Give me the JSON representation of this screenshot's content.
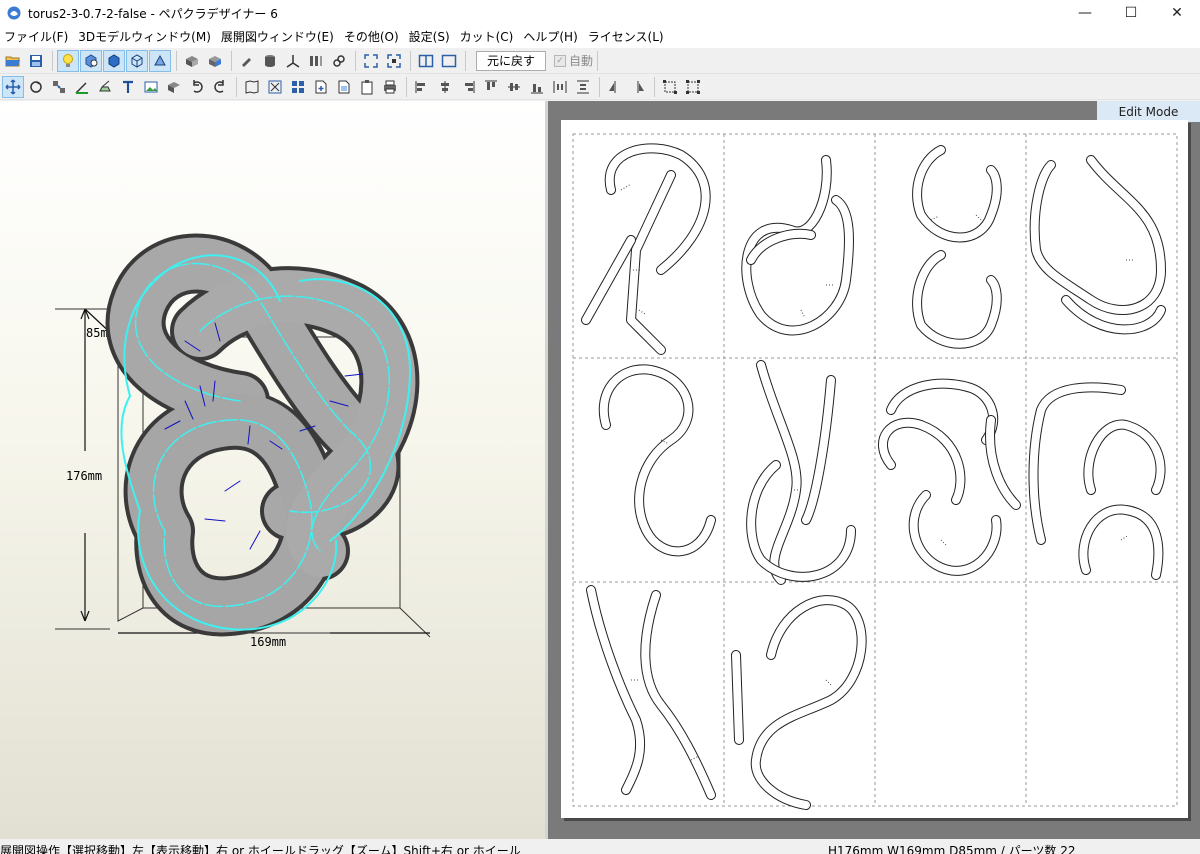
{
  "window": {
    "title": "torus2-3-0.7-2-false - ペパクラデザイナー 6",
    "minimize": "—",
    "maximize": "☐",
    "close": "✕"
  },
  "menu": [
    "ファイル(F)",
    "3Dモデルウィンドウ(M)",
    "展開図ウィンドウ(E)",
    "その他(O)",
    "設定(S)",
    "カット(C)",
    "ヘルプ(H)",
    "ライセンス(L)"
  ],
  "toolbar1": {
    "undo_label": "元に戻す",
    "auto_label": "自動"
  },
  "view2d": {
    "mode_label": "Edit Mode"
  },
  "view3d": {
    "dim_depth": "85mm",
    "dim_height": "176mm",
    "dim_width": "169mm"
  },
  "status": {
    "hint": "展開図操作【選択移動】左【表示移動】右 or ホイールドラッグ【ズーム】Shift+右 or ホイール",
    "info": "H176mm W169mm D85mm / パーツ数 22"
  },
  "colors": {
    "mesh_edge": "#3ff0f0",
    "fold_line": "#1010c0",
    "surface": "#a8a8a8",
    "mode_tab_bg": "#dbe8f5"
  }
}
